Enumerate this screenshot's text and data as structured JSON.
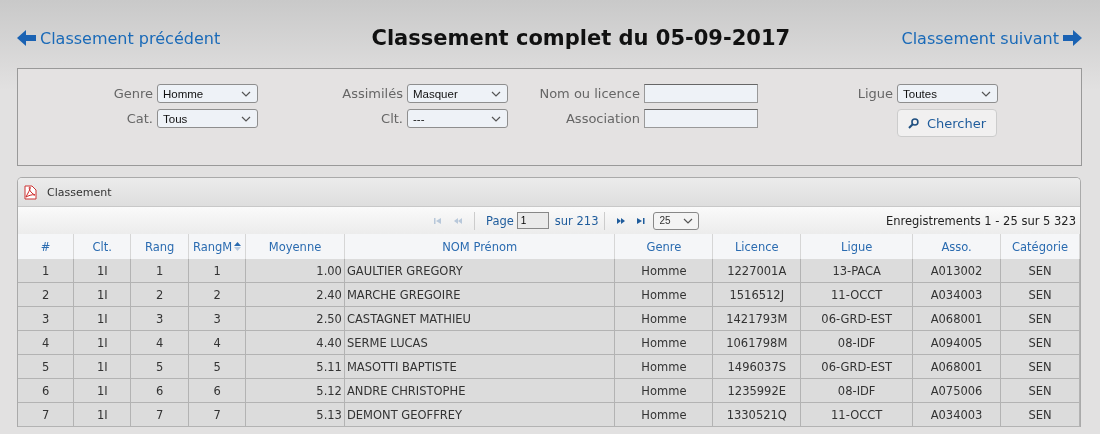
{
  "header": {
    "previous_link": "Classement précédent",
    "title": "Classement complet du 05-09-2017",
    "next_link": "Classement suivant"
  },
  "filters": {
    "left": [
      {
        "label": "Genre",
        "kind": "select",
        "value": "Homme"
      },
      {
        "label": "Cat.",
        "kind": "select",
        "value": "Tous"
      }
    ],
    "middle": [
      {
        "label": "Assimilés",
        "kind": "select",
        "value": "Masquer"
      },
      {
        "label": "Clt.",
        "kind": "select",
        "value": "---"
      }
    ],
    "text": [
      {
        "label": "Nom ou licence",
        "kind": "text"
      },
      {
        "label": "Association",
        "kind": "text"
      }
    ],
    "right": [
      {
        "label": "Ligue",
        "kind": "select",
        "value": "Toutes"
      }
    ],
    "search_button": "Chercher"
  },
  "grid": {
    "caption": "Classement",
    "pager": {
      "buttons": [
        {
          "kind": "first",
          "disabled": true
        },
        {
          "kind": "prev",
          "disabled": true
        },
        {
          "kind": "next",
          "disabled": false
        },
        {
          "kind": "last",
          "disabled": false
        }
      ],
      "page_label": "Page",
      "page_value": "1",
      "page_total": "sur 213",
      "page_size": "25",
      "records": "Enregistrements 1 - 25 sur 5 323"
    },
    "columns": [
      {
        "label": "#",
        "sorted": false
      },
      {
        "label": "Clt.",
        "sorted": false
      },
      {
        "label": "Rang",
        "sorted": false
      },
      {
        "label": "RangM",
        "sorted": true
      },
      {
        "label": "Moyenne",
        "sorted": false
      },
      {
        "label": "NOM Prénom",
        "sorted": false
      },
      {
        "label": "Genre",
        "sorted": false
      },
      {
        "label": "Licence",
        "sorted": false
      },
      {
        "label": "Ligue",
        "sorted": false
      },
      {
        "label": "Asso.",
        "sorted": false
      },
      {
        "label": "Catégorie",
        "sorted": false
      }
    ],
    "rows": [
      [
        "1",
        "1I",
        "1",
        "1",
        "1.00",
        "GAULTIER GREGORY",
        "Homme",
        "1227001A",
        "13-PACA",
        "A013002",
        "SEN"
      ],
      [
        "2",
        "1I",
        "2",
        "2",
        "2.40",
        "MARCHE GREGOIRE",
        "Homme",
        "1516512J",
        "11-OCCT",
        "A034003",
        "SEN"
      ],
      [
        "3",
        "1I",
        "3",
        "3",
        "2.50",
        "CASTAGNET MATHIEU",
        "Homme",
        "1421793M",
        "06-GRD-EST",
        "A068001",
        "SEN"
      ],
      [
        "4",
        "1I",
        "4",
        "4",
        "4.40",
        "SERME LUCAS",
        "Homme",
        "1061798M",
        "08-IDF",
        "A094005",
        "SEN"
      ],
      [
        "5",
        "1I",
        "5",
        "5",
        "5.11",
        "MASOTTI BAPTISTE",
        "Homme",
        "1496037S",
        "06-GRD-EST",
        "A068001",
        "SEN"
      ],
      [
        "6",
        "1I",
        "6",
        "6",
        "5.12",
        "ANDRE CHRISTOPHE",
        "Homme",
        "1235992E",
        "08-IDF",
        "A075006",
        "SEN"
      ],
      [
        "7",
        "1I",
        "7",
        "7",
        "5.13",
        "DEMONT GEOFFREY",
        "Homme",
        "1330521Q",
        "11-OCCT",
        "A034003",
        "SEN"
      ]
    ]
  }
}
